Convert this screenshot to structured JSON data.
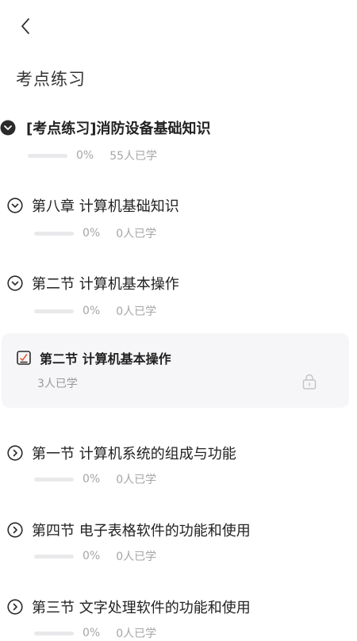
{
  "header": {
    "title": "考点练习"
  },
  "root": {
    "title": "[考点练习]消防设备基础知识",
    "progress": "0%",
    "learners": "55人已学",
    "progress_value": 0
  },
  "sections": [
    {
      "title": "第八章 计算机基础知识",
      "progress": "0%",
      "learners": "0人已学",
      "state": "expanded"
    },
    {
      "title": "第二节 计算机基本操作",
      "progress": "0%",
      "learners": "0人已学",
      "state": "expanded"
    },
    {
      "title": "第一节 计算机系统的组成与功能",
      "progress": "0%",
      "learners": "0人已学",
      "state": "collapsed"
    },
    {
      "title": "第四节 电子表格软件的功能和使用",
      "progress": "0%",
      "learners": "0人已学",
      "state": "collapsed"
    },
    {
      "title": "第三节 文字处理软件的功能和使用",
      "progress": "0%",
      "learners": "0人已学",
      "state": "collapsed"
    }
  ],
  "lesson": {
    "title": "第二节 计算机基本操作",
    "learners": "3人已学",
    "locked": true
  },
  "icons": {
    "back": "chevron-left-icon",
    "expanded_filled": "chevron-down-circle-filled-icon",
    "expanded": "chevron-down-circle-icon",
    "collapsed": "chevron-right-circle-icon",
    "lesson": "exercise-document-icon",
    "lock": "lock-icon"
  },
  "colors": {
    "text": "#222222",
    "muted": "#a6a6a6",
    "card_bg": "#f6f6f8",
    "bar_bg": "#e9e9ec"
  }
}
